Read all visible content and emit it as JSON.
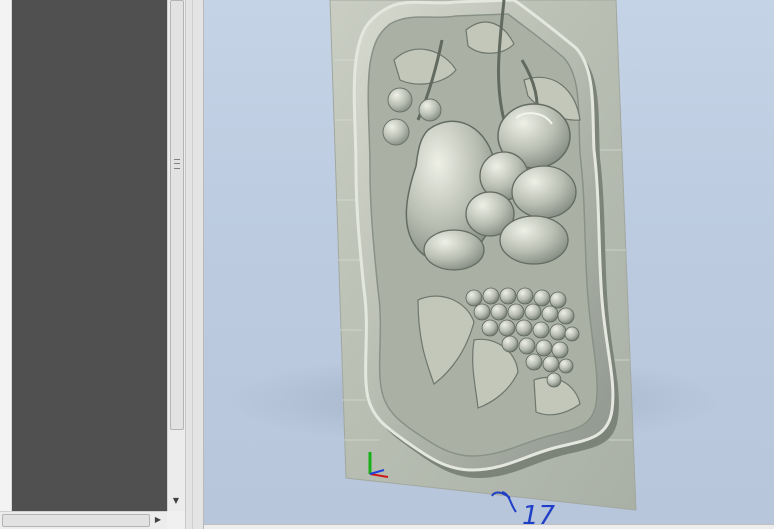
{
  "viewport": {
    "model_name": "fruit-relief-model",
    "colors": {
      "background_top": "#c5d3e6",
      "background_bottom": "#b8c6db",
      "model_base": "#b9bfb3",
      "annotation_ink": "#1f3fc8"
    },
    "axis_triad": {
      "x_color": "#d01818",
      "y_color": "#18b018",
      "z_color": "#2040e0"
    },
    "annotation_text": "17"
  },
  "left_panel": {
    "background": "#505050"
  }
}
